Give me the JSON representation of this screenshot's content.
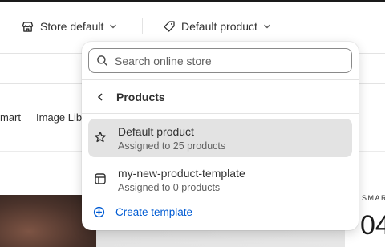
{
  "toolbar": {
    "store_label": "Store default",
    "product_label": "Default product"
  },
  "background": {
    "nav_items": [
      "mart",
      "Image Lib"
    ],
    "smart_label": "SMAR",
    "big_number": "04"
  },
  "dropdown": {
    "search_placeholder": "Search online store",
    "section_title": "Products",
    "options": [
      {
        "name": "Default product",
        "subtitle": "Assigned to 25 products",
        "icon": "star-icon",
        "selected": true
      },
      {
        "name": "my-new-product-template",
        "subtitle": "Assigned to 0 products",
        "icon": "template-icon",
        "selected": false
      }
    ],
    "create_label": "Create template"
  },
  "colors": {
    "accent": "#005bd3",
    "selected_bg": "#e3e3e3",
    "text": "#303030",
    "subtext": "#616161"
  }
}
